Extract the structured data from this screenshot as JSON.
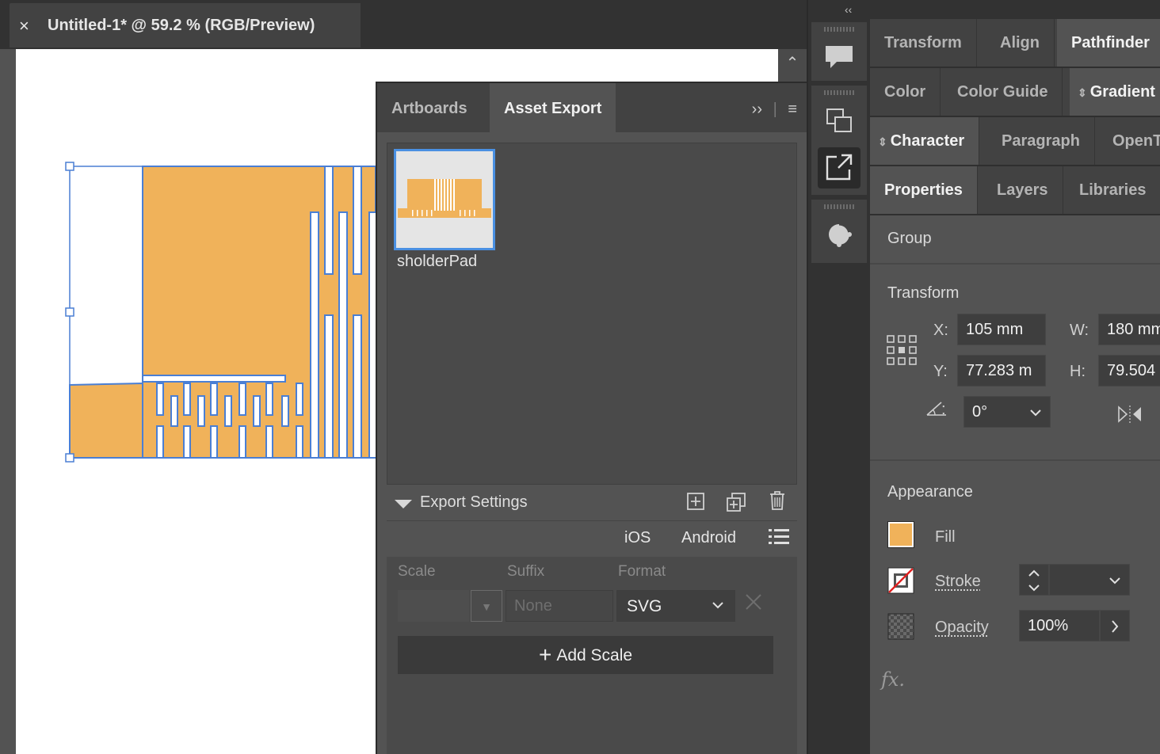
{
  "document": {
    "close_glyph": "×",
    "tab_title": "Untitled-1* @ 59.2 % (RGB/Preview)",
    "scroll_up_glyph": "⌃"
  },
  "artwork": {
    "fill_color": "#f0b25a",
    "selection_color": "#4a7fd4"
  },
  "asset_export_panel": {
    "tabs": [
      "Artboards",
      "Asset Export"
    ],
    "active_tab": "Asset Export",
    "menu_glyphs": {
      "more": "››",
      "menu": "≡"
    },
    "asset": {
      "label": "sholderPad"
    },
    "export_settings": {
      "title": "Export Settings",
      "platforms": [
        "iOS",
        "Android"
      ],
      "columns": [
        "Scale",
        "Suffix",
        "Format"
      ],
      "suffix_placeholder": "None",
      "format_value": "SVG",
      "add_scale_label": "Add Scale",
      "add_scale_glyph": "+"
    }
  },
  "dock": {
    "collapse_glyph": "‹‹"
  },
  "right_panel": {
    "tab_rows": [
      [
        "Transform",
        "Align",
        "Pathfinder"
      ],
      [
        "Color",
        "Color Guide",
        "Gradient"
      ],
      [
        "Character",
        "Paragraph",
        "OpenT"
      ],
      [
        "Properties",
        "Layers",
        "Libraries"
      ]
    ],
    "selection_type": "Group",
    "transform": {
      "title": "Transform",
      "x_label": "X:",
      "x_value": "105 mm",
      "y_label": "Y:",
      "y_value": "77.283 m",
      "w_label": "W:",
      "w_value": "180 mm",
      "h_label": "H:",
      "h_value": "79.504",
      "angle_label": ":",
      "angle_value": "0°"
    },
    "appearance": {
      "title": "Appearance",
      "fill_label": "Fill",
      "fill_color": "#f0b25a",
      "stroke_label": "Stroke",
      "opacity_label": "Opacity",
      "opacity_value": "100%",
      "fx_label": "fx."
    }
  }
}
